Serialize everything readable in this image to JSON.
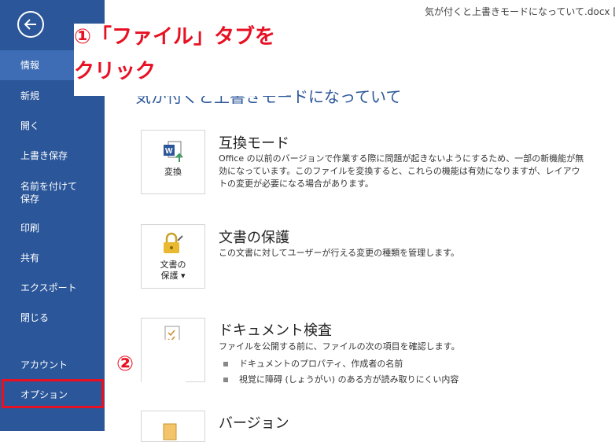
{
  "window": {
    "title": "気が付くと上書きモードになっていて.docx [互換モード"
  },
  "sidebar": {
    "back_label": "戻る",
    "items": [
      {
        "label": "情報"
      },
      {
        "label": "新規"
      },
      {
        "label": "開く"
      },
      {
        "label": "上書き保存"
      },
      {
        "label": "名前を付けて"
      },
      {
        "label": "保存"
      },
      {
        "label": "印刷"
      },
      {
        "label": "共有"
      },
      {
        "label": "エクスポート"
      },
      {
        "label": "閉じる"
      },
      {
        "label": "アカウント"
      },
      {
        "label": "オプション"
      }
    ]
  },
  "annotations": {
    "step1_line1": "①「ファイル」タブを",
    "step1_line2": "クリック",
    "step2": "②"
  },
  "page": {
    "heading": "気が付くと上書きモードになっていて"
  },
  "sections": {
    "compat": {
      "button_label": "変換",
      "title": "互換モード",
      "desc": "Office の以前のバージョンで作業する際に問題が起きないようにするため、一部の新機能が無効になっています。このファイルを変換すると、これらの機能は有効になりますが、レイアウトの変更が必要になる場合があります。"
    },
    "protect": {
      "button_line1": "文書の",
      "button_line2": "保護 ▾",
      "title": "文書の保護",
      "desc": "この文書に対してユーザーが行える変更の種類を管理します。"
    },
    "inspect": {
      "title": "ドキュメント検査",
      "desc": "ファイルを公開する前に、ファイルの次の項目を確認します。",
      "bullets": [
        "ドキュメントのプロパティ、作成者の名前",
        "視覚に障碍 (しょうがい) のある方が読み取りにくい内容"
      ]
    },
    "version": {
      "title": "バージョン"
    }
  }
}
